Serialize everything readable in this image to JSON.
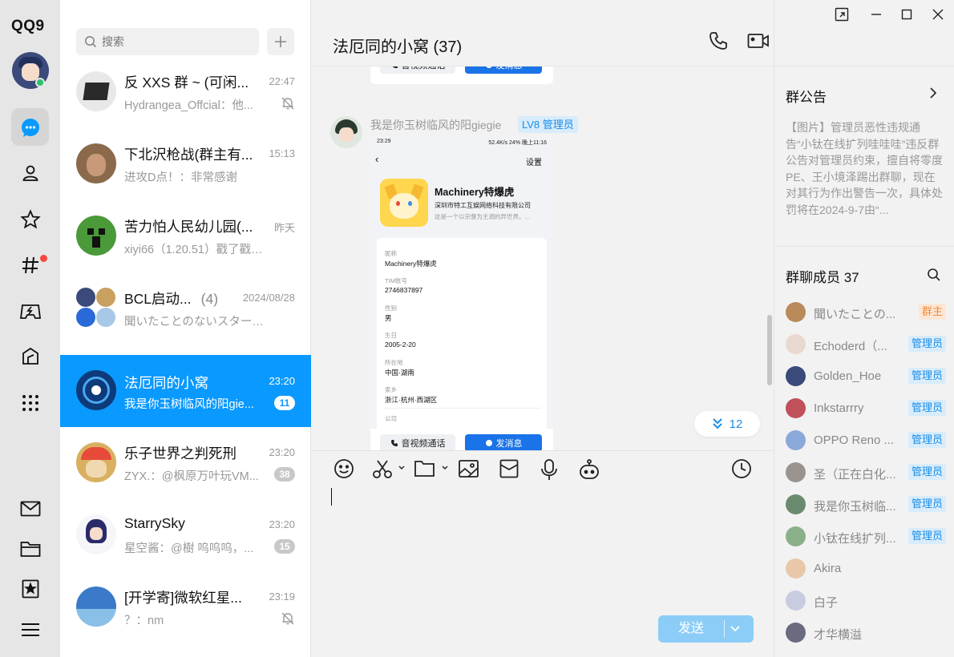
{
  "app": {
    "logo": "QQ9"
  },
  "search": {
    "placeholder": "搜索"
  },
  "conversations": [
    {
      "name": "反 XXS 群 ~ (可闲...",
      "time": "22:47",
      "message": "Hydrangea_Offcial：他...",
      "muted": true,
      "badge": "",
      "member_count": ""
    },
    {
      "name": "下北沢枪战(群主有...",
      "time": "15:13",
      "message": "进攻D点！：非常感谢",
      "muted": false,
      "badge": "",
      "member_count": ""
    },
    {
      "name": "苦力怕人民幼儿园(...",
      "time": "昨天",
      "message": "xiyi66（1.20.51）戳了戳19...",
      "muted": false,
      "badge": "",
      "member_count": ""
    },
    {
      "name": "BCL启动...",
      "time": "2024/08/28",
      "message": "聞いたことのないスターの...",
      "muted": false,
      "badge": "",
      "member_count": "(4)"
    },
    {
      "name": "法厄同的小窝",
      "time": "23:20",
      "message": "我是你玉树临风的阳gie...",
      "muted": false,
      "badge": "11",
      "member_count": "",
      "active": true
    },
    {
      "name": "乐子世界之判死刑",
      "time": "23:20",
      "message": "ZYX.：@枫原万叶玩VM...",
      "muted": false,
      "badge": "38",
      "member_count": ""
    },
    {
      "name": "StarrySky",
      "time": "23:20",
      "message": "星空酱：@樹 呜呜呜，...",
      "muted": false,
      "badge": "15",
      "member_count": ""
    },
    {
      "name": "[开学寄]微软红星...",
      "time": "23:19",
      "message": "？：nm",
      "muted": true,
      "badge": "",
      "member_count": ""
    }
  ],
  "chat": {
    "title": "法厄同的小窝 (37)",
    "card_buttons": {
      "call": "音视频通话",
      "message": "发消息"
    },
    "sender": {
      "name": "我是你玉树临风的阳giegie",
      "role": "LV8 管理员"
    },
    "screenshot": {
      "status_left": "23:29",
      "status_right": "52.4K/s 24% 晚上11:16",
      "settings": "设置",
      "profile_name": "Machinery特爆虎",
      "company": "深圳市特工互娱网络科技有限公司",
      "description": "这是一个以宗督为主调的异世界。...",
      "fields": [
        {
          "label": "昵称",
          "value": "Machinery特爆虎"
        },
        {
          "label": "TIM账号",
          "value": "2746837897"
        },
        {
          "label": "性别",
          "value": "男"
        },
        {
          "label": "生日",
          "value": "2005-2-20"
        },
        {
          "label": "所在地",
          "value": "中国·湖南"
        },
        {
          "label": "家乡",
          "value": "浙江·杭州·西湖区"
        }
      ],
      "last_label": "公司"
    },
    "unread_count": "12",
    "send_label": "发送"
  },
  "notice": {
    "title": "群公告",
    "text": "【图片】管理员恶性违规通告“小钛在线扩列哇哇哇”违反群公告对管理员约束，擅自将零度PE、王小境泽踢出群聊，现在对其行为作出警告一次，具体处罚将在2024-9-7由“..."
  },
  "members": {
    "title": "群聊成员 37",
    "list": [
      {
        "name": "聞いたことの...",
        "role": "群主",
        "type": "owner",
        "color": "#b98a5a"
      },
      {
        "name": "Echoderd（...",
        "role": "管理员",
        "type": "admin",
        "color": "#e8d8d0"
      },
      {
        "name": "Golden_Hoe",
        "role": "管理员",
        "type": "admin",
        "color": "#3a4a7a"
      },
      {
        "name": "Inkstarrry",
        "role": "管理员",
        "type": "admin",
        "color": "#c0505a"
      },
      {
        "name": "OPPO Reno ...",
        "role": "管理员",
        "type": "admin",
        "color": "#8aa8d8"
      },
      {
        "name": "圣（正在白化...",
        "role": "管理员",
        "type": "admin",
        "color": "#9a9490"
      },
      {
        "name": "我是你玉树临...",
        "role": "管理员",
        "type": "admin",
        "color": "#6a8a70"
      },
      {
        "name": "小钛在线扩列...",
        "role": "管理员",
        "type": "admin",
        "color": "#8ab08a"
      },
      {
        "name": "Akira",
        "role": "",
        "type": "",
        "color": "#e8c8a8"
      },
      {
        "name": "白子",
        "role": "",
        "type": "",
        "color": "#c8cce0"
      },
      {
        "name": "才华横溢",
        "role": "",
        "type": "",
        "color": "#6a6a80"
      }
    ]
  },
  "colors": {
    "accent": "#0a99ff",
    "admin_tag": "#1a8ee8",
    "owner_tag": "#f08c3c",
    "send_disabled": "#8ccdf8"
  }
}
